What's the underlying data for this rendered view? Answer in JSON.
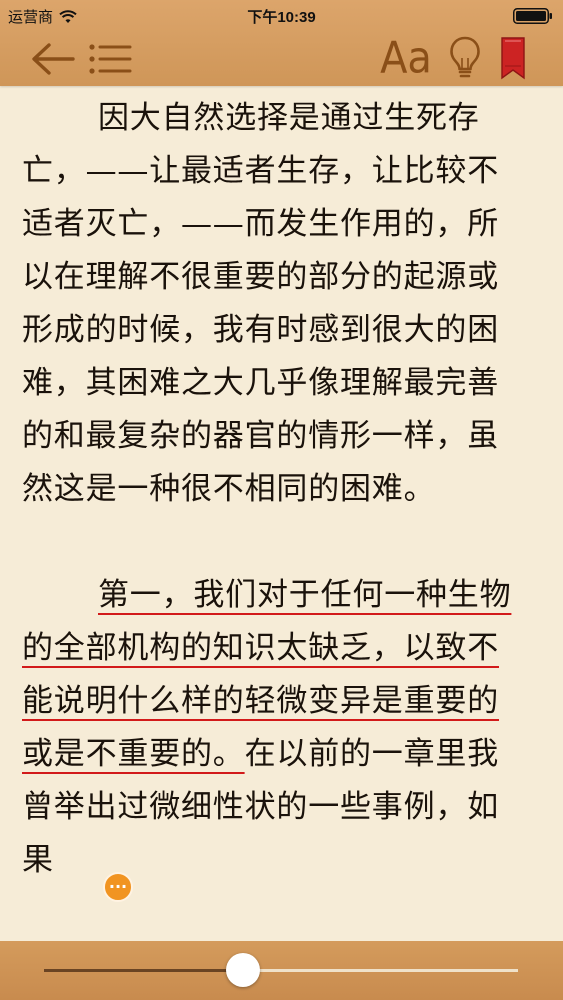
{
  "status_bar": {
    "carrier": "运营商",
    "time": "下午10:39"
  },
  "toolbar": {
    "back_icon": "back-arrow-icon",
    "toc_icon": "list-icon",
    "font_label": "Aa",
    "brightness_icon": "lightbulb-icon",
    "bookmark_icon": "bookmark-icon"
  },
  "reader": {
    "paragraph_1": "因大自然选择是通过生死存亡，——让最适者生存，让比较不适者灭亡，——而发生作用的，所以在理解不很重要的部分的起源或形成的时候，我有时感到很大的困难，其困难之大几乎像理解最完善的和最复杂的器官的情形一样，虽然这是一种很不相同的困难。",
    "paragraph_2_highlighted": "第一，我们对于任何一种生物的全部机构的知识太缺乏，以致不能说明什么样的轻微变异是重要的或是不重要的。",
    "paragraph_2_rest": "在以前的一章里我曾举出过微细性状的一些事例，如果",
    "note_marker": "···"
  },
  "progress": {
    "fraction": 0.42
  },
  "colors": {
    "toolbar": "#d49b5c",
    "icon": "#8a4f18",
    "page": "#f6ecd7",
    "highlight_underline": "#d21a1a",
    "bookmark": "#cc2323",
    "note_marker": "#f19421"
  }
}
